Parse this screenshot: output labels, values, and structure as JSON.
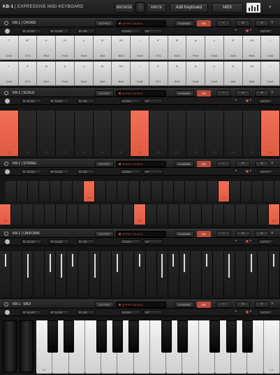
{
  "topbar": {
    "app": "KB-1",
    "subtitle": "| EXPRESSIVE MIDI KEYBOARD",
    "browse": "BROWSE",
    "write": "WRITE",
    "add_keyboard": "Add Keyboard",
    "midi": "MIDI"
  },
  "common": {
    "output": "OUTPUT",
    "device": "MYPHT DEVICE",
    "channel": "CHANNEL",
    "channel_value": "RE",
    "minus": "−",
    "plus": "+",
    "glide": "GLIDE",
    "slide": "SLIDE",
    "vel": "VEL",
    "down": "DOWN",
    "up": "UP",
    "latch": "LATCH"
  },
  "modules": [
    {
      "name": "KB-1 | CHORD"
    },
    {
      "name": "KB-1 | SCALE"
    },
    {
      "name": "KB-1 | STRING"
    },
    {
      "name": "KB-1 | UNIFORM"
    },
    {
      "name": "KB-1 - MIDI"
    }
  ],
  "chord": {
    "top_row": [
      {
        "t": "7",
        "b": "Cm2"
      },
      {
        "t": "III°",
        "b": "D°3"
      },
      {
        "t": "#",
        "b": "Eb3"
      },
      {
        "t": "IV",
        "b": "Fm3"
      },
      {
        "t": "v",
        "b": "Gm3"
      },
      {
        "t": "VI",
        "b": "Ab3"
      },
      {
        "t": "VII",
        "b": "Bb3"
      },
      {
        "t": "i",
        "b": "Cm3"
      },
      {
        "t": "ii°",
        "b": "D°3"
      },
      {
        "t": "III",
        "b": "Eb3"
      },
      {
        "t": "iv",
        "b": "Fm3"
      },
      {
        "t": "v",
        "b": "Gm3"
      },
      {
        "t": "VI",
        "b": "Ab3"
      },
      {
        "t": "VII",
        "b": "Bb3"
      },
      {
        "t": "i",
        "b": "Cm4"
      }
    ],
    "bottom_row": [
      {
        "t": "i",
        "b": "Cm2"
      },
      {
        "t": "ii°",
        "b": "D°3"
      },
      {
        "t": "III",
        "b": "Eb3"
      },
      {
        "t": "iv",
        "b": "Fm3"
      },
      {
        "t": "v",
        "b": "Gm3"
      },
      {
        "t": "VI",
        "b": "Ab3"
      },
      {
        "t": "VII",
        "b": "Bb3"
      },
      {
        "t": "i",
        "b": "Cm3"
      },
      {
        "t": "ii°",
        "b": "D°3"
      },
      {
        "t": "III",
        "b": "Eb3"
      },
      {
        "t": "iv",
        "b": "Fm3"
      },
      {
        "t": "v",
        "b": "Gm3"
      },
      {
        "t": "VI",
        "b": "Ab3"
      },
      {
        "t": "VII",
        "b": "Bb3"
      },
      {
        "t": "i",
        "b": "Cm4"
      }
    ]
  },
  "scale": {
    "labels": [
      "C2",
      "D2",
      "E2",
      "F2",
      "G2",
      "A2",
      "B2",
      "C3",
      "D3",
      "E3",
      "F3",
      "G3",
      "A3",
      "B3",
      "C4"
    ],
    "active": [
      0,
      7,
      14
    ]
  },
  "string": {
    "top_labels": [
      "",
      "",
      "",
      "",
      "",
      "",
      "",
      "",
      "",
      "",
      "",
      "",
      "",
      "",
      "",
      "",
      "",
      "",
      "",
      "",
      "",
      "",
      "",
      "",
      "",
      "",
      "",
      "",
      "",
      "",
      "",
      "",
      "",
      "",
      "",
      "",
      "",
      "",
      "",
      "",
      "",
      ""
    ],
    "top_active_labels": {
      "7": "C3",
      "19": "C3"
    },
    "bottom_labels": {
      "0": "C2",
      "12": "C3",
      "24": "C4"
    },
    "top_active": [
      7,
      19
    ],
    "bottom_active": [
      0,
      12,
      24
    ]
  },
  "uniform": {
    "count": 25
  },
  "midi": {
    "labels": {
      "0": "C3",
      "14": "C4"
    }
  },
  "colors": {
    "accent": "#e05a42",
    "channel_red": "#b94a3a"
  }
}
